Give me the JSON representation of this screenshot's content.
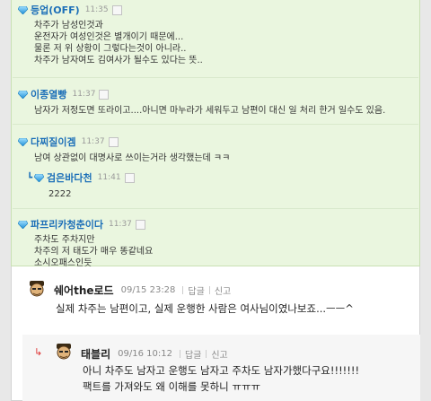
{
  "chat": {
    "entries": [
      {
        "nick": "등업(OFF)",
        "time": "11:35",
        "lines": [
          "차주가 남성인것과",
          "운전자가 여성인것은 별개이기 때문에...",
          "물론 저 위 상황이 그렇다는것이 아니라..",
          "차주가 남자여도 김여사가 될수도 있다는 뜻.."
        ]
      },
      {
        "nick": "이종열빵",
        "time": "11:37",
        "lines": [
          "남자가 저정도면 또라이고....아니면 마누라가 세워두고 남편이 대신 일 처리 한거 일수도 있음."
        ]
      },
      {
        "nick": "다찌질이겜",
        "time": "11:37",
        "lines": [
          "남여 상관없이 대명사로 쓰이는거라 생각했는데 ㅋㅋ"
        ]
      },
      {
        "nick": "파프리카청춘이다",
        "time": "11:37",
        "lines": [
          "주차도 주차지만",
          "차주의 저 태도가 매우 똥같네요",
          "소시오패스인듯"
        ]
      }
    ],
    "nested_reply": {
      "nick": "검은바다천",
      "time": "11:41",
      "text": "2222"
    }
  },
  "comments": [
    {
      "nick": "쉐어the로드",
      "date": "09/15 23:28",
      "reply_label": "답글",
      "report_label": "신고",
      "lines": [
        "실제 차주는 남편이고, 실제 운행한 사람은 여사님이였나보죠...ㅡㅡ^"
      ]
    },
    {
      "nick": "태블리",
      "date": "09/16 10:12",
      "reply_label": "답글",
      "report_label": "신고",
      "lines": [
        "아니 차주도 남자고 운행도 남자고 주차도 남자가했다구요!!!!!!!",
        "팩트를 가져와도 왜 이해를 못하니 ㅠㅠㅠ"
      ]
    }
  ],
  "icons": {
    "gem": "diamond-icon",
    "reply_arrow": "reply-arrow-icon",
    "level": "level-badge-icon",
    "avatar": "avatar-icon"
  },
  "colors": {
    "nick": "#1c6fb8",
    "chat_bg": "#eaf6df",
    "reply_arrow": "#dd3333"
  }
}
